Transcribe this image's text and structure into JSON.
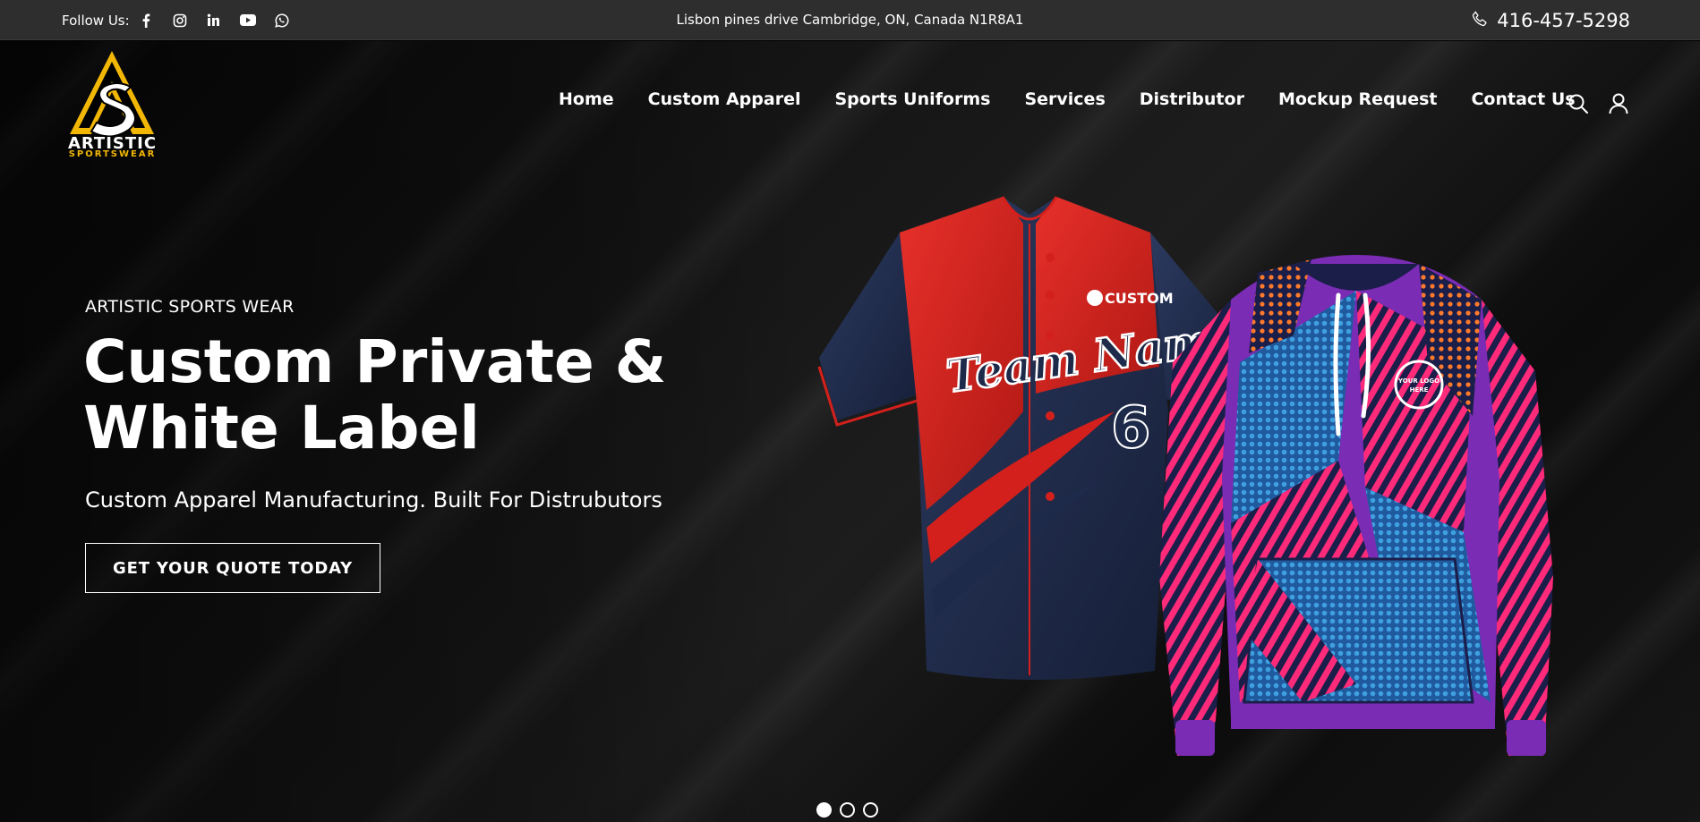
{
  "topbar": {
    "follow_label": "Follow Us:",
    "social_icons": [
      "facebook-icon",
      "instagram-icon",
      "linkedin-icon",
      "youtube-icon",
      "whatsapp-icon"
    ],
    "address": "Lisbon pines drive Cambridge, ON, Canada N1R8A1",
    "phone": "416-457-5298"
  },
  "brand": {
    "name": "ARTISTIC",
    "tagline": "SPORTSWEAR",
    "accent": "#f2b705"
  },
  "nav": {
    "items": [
      "Home",
      "Custom Apparel",
      "Sports Uniforms",
      "Services",
      "Distributor",
      "Mockup Request",
      "Contact Us"
    ],
    "icons": [
      "search-icon",
      "user-icon"
    ]
  },
  "hero": {
    "eyebrow": "ARTISTIC SPORTS WEAR",
    "headline_line1": "Custom Private &",
    "headline_line2": "White Label",
    "subhead": "Custom Apparel Manufacturing. Built For Distrubutors",
    "cta": "GET YOUR QUOTE TODAY",
    "jersey": {
      "brand": "CUSTOM",
      "team_name": "Team Name",
      "number": "6",
      "colors": {
        "red": "#d4201c",
        "navy": "#1e2a4a"
      }
    },
    "hoodie": {
      "logo_text_line1": "YOUR LOGO",
      "logo_text_line2": "HERE",
      "colors": {
        "pink": "#ff2a7a",
        "blue": "#2b7fc9",
        "purple": "#7a2cb5",
        "orange": "#ff7a2a"
      }
    }
  },
  "slider": {
    "slide_count": 3,
    "active_index": 0
  }
}
